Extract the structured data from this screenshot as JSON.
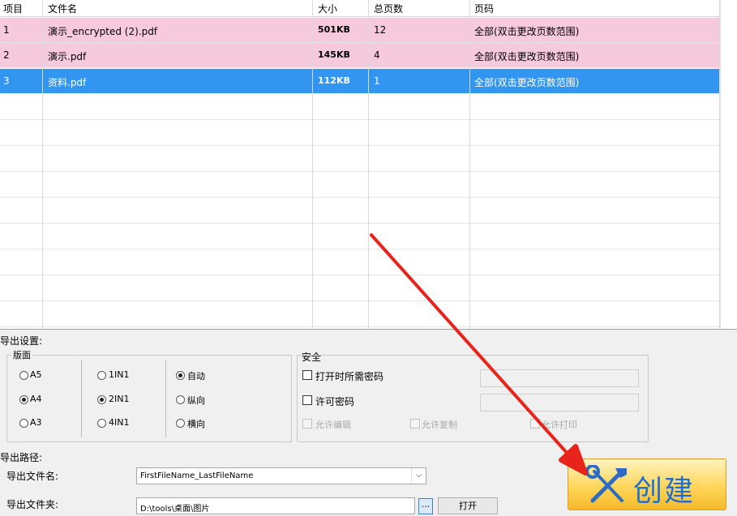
{
  "table": {
    "headers": {
      "index": "项目",
      "filename": "文件名",
      "size": "大小",
      "pages": "总页数",
      "range": "页码"
    },
    "rows": [
      {
        "index": "1",
        "filename": "演示_encrypted (2).pdf",
        "size": "501KB",
        "pages": "12",
        "range": "全部(双击更改页数范围)",
        "state": "pink"
      },
      {
        "index": "2",
        "filename": "演示.pdf",
        "size": "145KB",
        "pages": "4",
        "range": "全部(双击更改页数范围)",
        "state": "pink"
      },
      {
        "index": "3",
        "filename": "资料.pdf",
        "size": "112KB",
        "pages": "1",
        "range": "全部(双击更改页数范围)",
        "state": "blue"
      }
    ]
  },
  "export_settings": {
    "title": "导出设置:",
    "layout_group": {
      "title": "版面",
      "paper": [
        {
          "label": "A5",
          "checked": false
        },
        {
          "label": "A4",
          "checked": true
        },
        {
          "label": "A3",
          "checked": false
        }
      ],
      "nup": [
        {
          "label": "1IN1",
          "checked": false
        },
        {
          "label": "2IN1",
          "checked": true
        },
        {
          "label": "4IN1",
          "checked": false
        }
      ],
      "orientation": [
        {
          "label": "自动",
          "checked": true
        },
        {
          "label": "纵向",
          "checked": false
        },
        {
          "label": "横向",
          "checked": false
        }
      ]
    },
    "security": {
      "title": "安全",
      "open_password": "打开时所需密码",
      "permission_password": "许可密码",
      "allow_edit": "允许编辑",
      "allow_copy": "允许复制",
      "allow_print": "允许打印"
    }
  },
  "export_path": {
    "title": "导出路径:",
    "filename_label": "导出文件名:",
    "filename_value": "FirstFileName_LastFileName",
    "folder_label": "导出文件夹:",
    "folder_value": "D:\\tools\\桌面\\图片",
    "browse_label": "...",
    "open_label": "打开"
  },
  "create_button": {
    "label": "创建"
  },
  "colors": {
    "row_pink": "#f7c9dc",
    "row_selected": "#3296f0",
    "create_text": "#1e6fd0",
    "annotation_arrow": "#e8231c"
  }
}
